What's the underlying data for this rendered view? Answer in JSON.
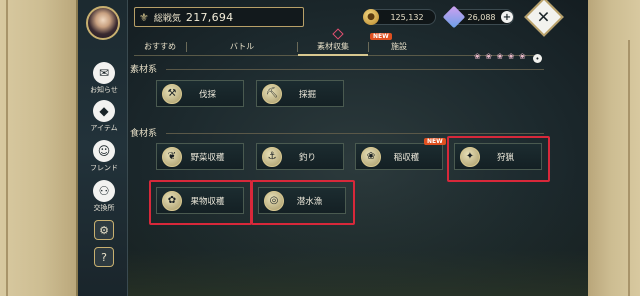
{
  "header": {
    "power_icon": "crest-icon",
    "power_label": "総戦気",
    "power_value": "217,694",
    "coins": "125,132",
    "gems": "26,088",
    "plus": "+"
  },
  "sidebar": {
    "items": [
      {
        "label": "お知らせ",
        "icon": "mail-icon",
        "glyph": "✉"
      },
      {
        "label": "アイテム",
        "icon": "bag-icon",
        "glyph": "◆"
      },
      {
        "label": "フレンド",
        "icon": "friend-icon",
        "glyph": "☺"
      },
      {
        "label": "交換所",
        "icon": "exchange-icon",
        "glyph": "⚇"
      }
    ],
    "settings_glyph": "⚙",
    "help_glyph": "?"
  },
  "tabs": [
    {
      "label": "おすすめ"
    },
    {
      "label": "バトル"
    },
    {
      "label": "素材収集",
      "active": true
    },
    {
      "label": "施設"
    }
  ],
  "new_badge": "NEW",
  "sections": {
    "materials": {
      "title": "素材系",
      "actions": [
        {
          "label": "伐採",
          "icon": "axe-icon",
          "glyph": "⚒"
        },
        {
          "label": "採掘",
          "icon": "pickaxe-icon",
          "glyph": "⛏"
        }
      ]
    },
    "food": {
      "title": "食材系",
      "actions": [
        {
          "label": "野菜収穫",
          "icon": "vegetable-icon",
          "glyph": "❦"
        },
        {
          "label": "釣り",
          "icon": "fishing-icon",
          "glyph": "⚓"
        },
        {
          "label": "稲収穫",
          "icon": "rice-icon",
          "glyph": "❀",
          "badge": "NEW"
        },
        {
          "label": "狩猟",
          "icon": "hunting-icon",
          "glyph": "✦",
          "highlight": true
        },
        {
          "label": "果物収穫",
          "icon": "fruit-icon",
          "glyph": "✿",
          "highlight": true
        },
        {
          "label": "潜水漁",
          "icon": "diving-icon",
          "glyph": "◎",
          "highlight": true
        }
      ]
    }
  },
  "close_glyph": "✕",
  "colors": {
    "highlight": "#d8283a",
    "accent_gold": "#d8c890",
    "new_badge": "#e05020"
  }
}
